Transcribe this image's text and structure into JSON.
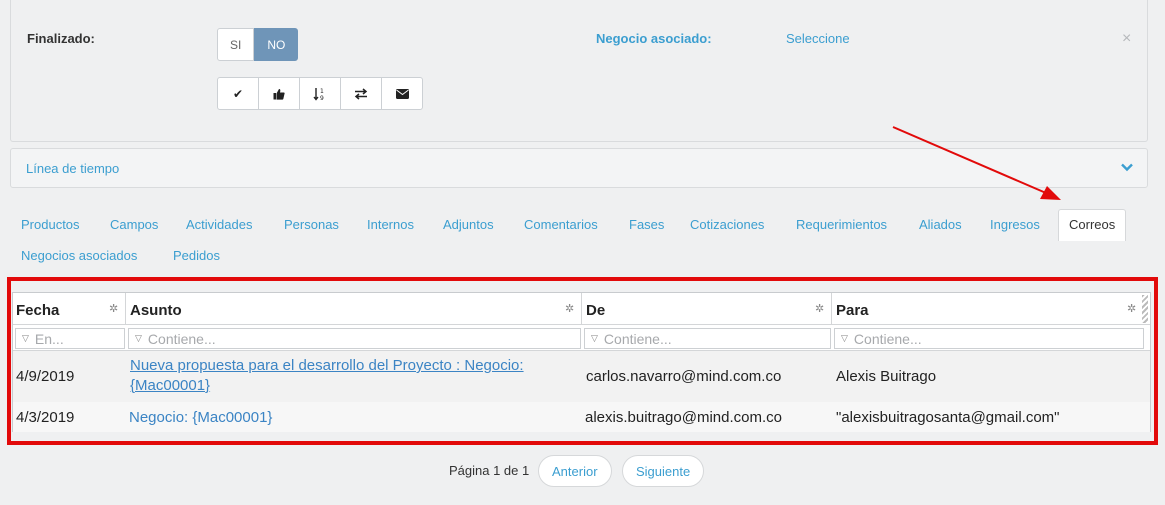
{
  "top_panel": {
    "finalizado_label": "Finalizado:",
    "toggle_si": "SI",
    "toggle_no": "NO",
    "toggle_selected": "NO",
    "negocio_label": "Negocio asociado:",
    "negocio_link": "Seleccione",
    "close_symbol": "×"
  },
  "action_buttons": [
    {
      "icon": "check-icon",
      "glyph": "✔"
    },
    {
      "icon": "thumbs-up-icon",
      "glyph": "👍"
    },
    {
      "icon": "sort-numeric-icon",
      "glyph": "↓¹₉"
    },
    {
      "icon": "exchange-icon",
      "glyph": "⇄"
    },
    {
      "icon": "envelope-icon",
      "glyph": "✉"
    }
  ],
  "timeline": {
    "label": "Línea de tiempo"
  },
  "tabs": {
    "row1": [
      "Productos",
      "Campos",
      "Actividades",
      "Personas",
      "Internos",
      "Adjuntos",
      "Comentarios",
      "Fases",
      "Cotizaciones",
      "Requerimientos",
      "Aliados",
      "Ingresos",
      "Correos"
    ],
    "row2": [
      "Negocios asociados",
      "Pedidos"
    ],
    "active": "Correos"
  },
  "grid": {
    "columns": [
      "Fecha",
      "Asunto",
      "De",
      "Para"
    ],
    "filters": {
      "fecha": "En...",
      "asunto": "Contiene...",
      "de": "Contiene...",
      "para": "Contiene..."
    },
    "rows": [
      {
        "fecha": "4/9/2019",
        "asunto_line1": "Nueva propuesta para el desarrollo del Proyecto : Negocio:",
        "asunto_line2": "{Mac00001}",
        "de": "carlos.navarro@mind.com.co",
        "para": "Alexis Buitrago"
      },
      {
        "fecha": "4/3/2019",
        "asunto": "Negocio: {Mac00001}",
        "de": "alexis.buitrago@mind.com.co",
        "para": "\"alexisbuitragosanta@gmail.com\""
      }
    ]
  },
  "pager": {
    "text": "Página 1 de 1",
    "prev": "Anterior",
    "next": "Siguiente"
  },
  "colors": {
    "accent": "#3b9ed0",
    "toggle_active": "#6f95b8",
    "highlight_red": "#e20a0a"
  }
}
